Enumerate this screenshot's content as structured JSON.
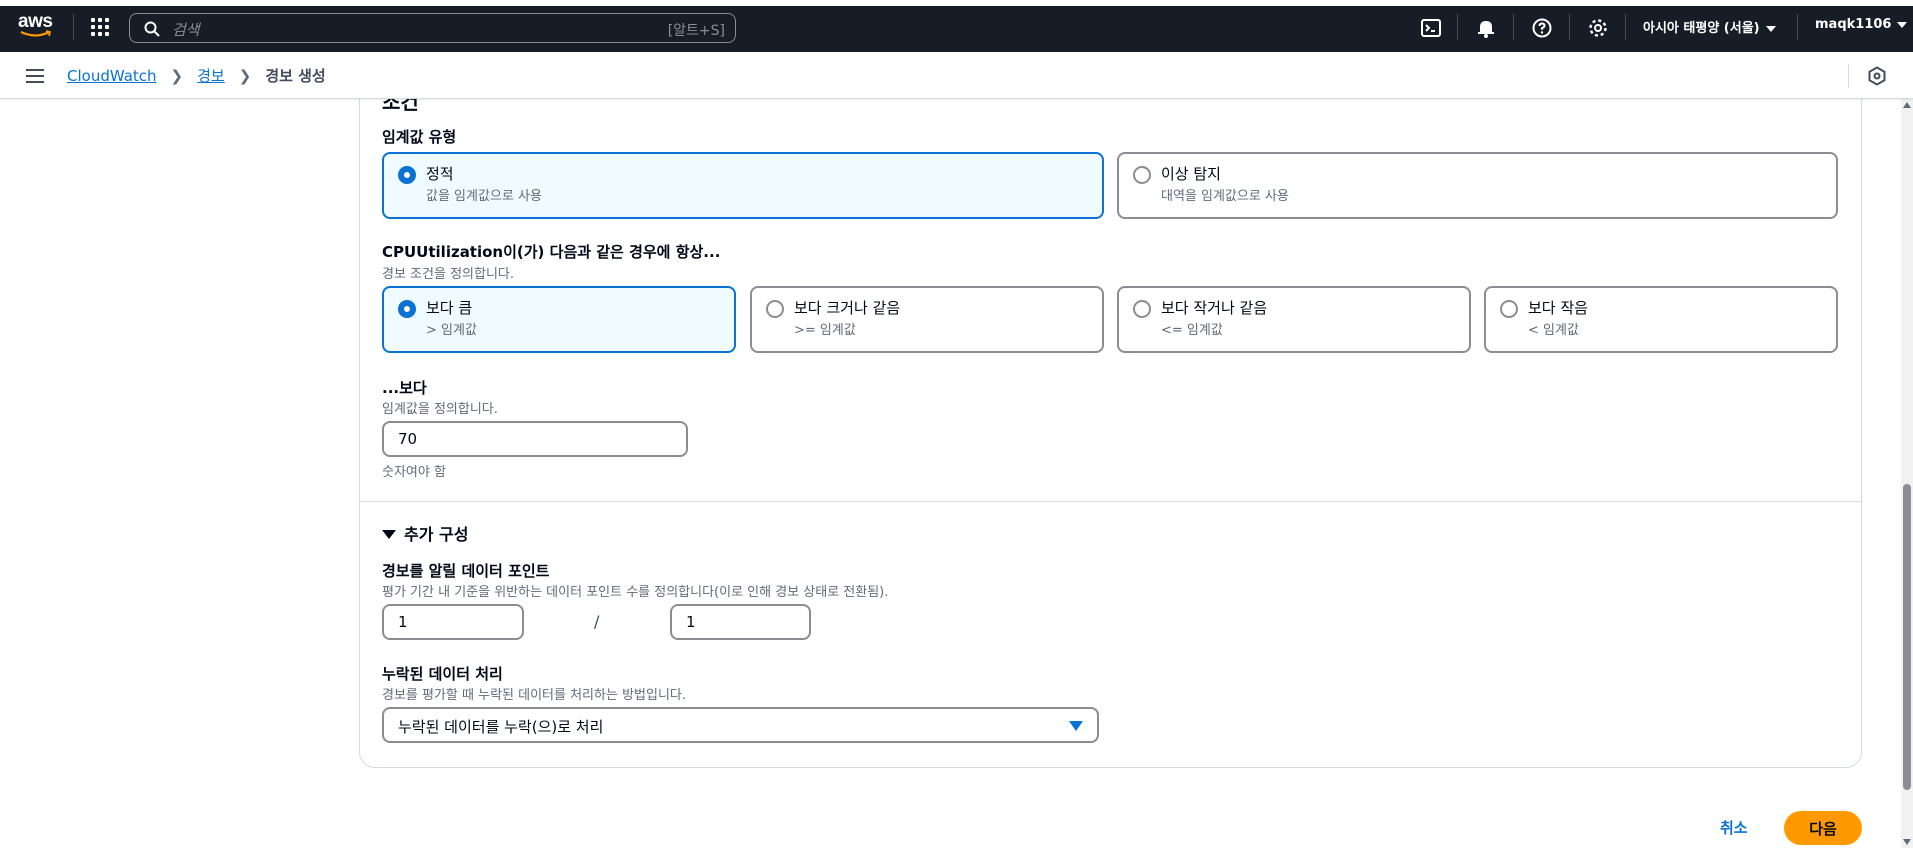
{
  "topnav": {
    "logo_text": "aws",
    "search_placeholder": "검색",
    "search_shortcut": "[알트+S]",
    "region": "아시아 태평양 (서울)",
    "user": "maqk1106"
  },
  "breadcrumb": {
    "items": [
      "CloudWatch",
      "경보"
    ],
    "current": "경보 생성"
  },
  "conditions": {
    "section_title": "조건",
    "threshold_type": {
      "label": "임계값 유형",
      "options": [
        {
          "title": "정적",
          "subtitle": "값을 임계값으로 사용",
          "selected": true
        },
        {
          "title": "이상 탐지",
          "subtitle": "대역을 임계값으로 사용",
          "selected": false
        }
      ]
    },
    "whenever": {
      "label": "CPUUtilization이(가) 다음과 같은 경우에 항상...",
      "description": "경보 조건을 정의합니다.",
      "options": [
        {
          "title": "보다 큼",
          "subtitle": "> 임계값",
          "selected": true
        },
        {
          "title": "보다 크거나 같음",
          "subtitle": ">= 임계값",
          "selected": false
        },
        {
          "title": "보다 작거나 같음",
          "subtitle": "<= 임계값",
          "selected": false
        },
        {
          "title": "보다 작음",
          "subtitle": "< 임계값",
          "selected": false
        }
      ]
    },
    "than": {
      "label": "...보다",
      "description": "임계값을 정의합니다.",
      "value": "70",
      "constraint": "숫자여야 함"
    }
  },
  "additional": {
    "toggle_label": "추가 구성",
    "datapoints": {
      "label": "경보를 알릴 데이터 포인트",
      "description": "평가 기간 내 기준을 위반하는 데이터 포인트 수를 정의합니다(이로 인해 경보 상태로 전환됨).",
      "value_a": "1",
      "separator": "/",
      "value_b": "1"
    },
    "missing_data": {
      "label": "누락된 데이터 처리",
      "description": "경보를 평가할 때 누락된 데이터를 처리하는 방법입니다.",
      "selected": "누락된 데이터를 누락(으)로 처리"
    }
  },
  "footer": {
    "cancel": "취소",
    "next": "다음"
  },
  "colors": {
    "nav_bg": "#161d26",
    "accent": "#0972d3",
    "primary_button": "#ff9900"
  }
}
